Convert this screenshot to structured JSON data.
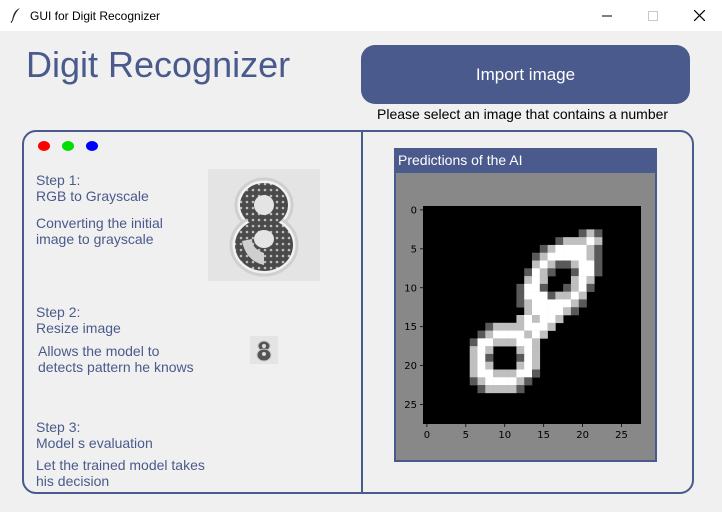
{
  "window": {
    "title": "GUI for Digit Recognizer",
    "icon": "feather-icon"
  },
  "header": {
    "title": "Digit Recognizer",
    "import_label": "Import image",
    "hint": "Please select an image that contains a number"
  },
  "status_dots": {
    "colors": [
      "#ff0000",
      "#00dd00",
      "#0000ff"
    ]
  },
  "steps": [
    {
      "title": "Step 1:",
      "name": "RGB to Grayscale",
      "desc1": "Converting the initial",
      "desc2": "image to grayscale"
    },
    {
      "title": "Step 2:",
      "name": "Resize image",
      "desc1": "Allows the model to",
      "desc2": "detects pattern he knows"
    },
    {
      "title": "Step 3:",
      "name": "Model s evaluation",
      "desc1": "Let the trained model takes",
      "desc2": "his decision"
    }
  ],
  "prediction": {
    "header": "Predictions of the AI",
    "y_ticks": [
      "0",
      "5",
      "10",
      "15",
      "20",
      "25"
    ],
    "x_ticks": [
      "0",
      "5",
      "10",
      "15",
      "20",
      "25"
    ]
  },
  "colors": {
    "accent": "#4a5a8c",
    "background": "#f0f0f0",
    "panel_bg": "#888888"
  }
}
